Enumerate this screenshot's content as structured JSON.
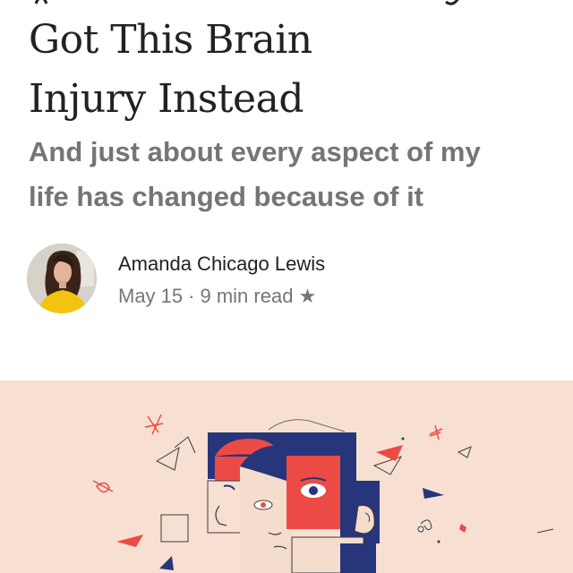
{
  "article": {
    "title_lines": [
      "Got This Brain",
      "Injury Instead"
    ],
    "subtitle_lines": [
      "And just about every aspect of my",
      "life has changed because of it"
    ],
    "author": {
      "name": "Amanda Chicago Lewis"
    },
    "meta": {
      "date": "May 15",
      "separator": "·",
      "read_time": "9 min read",
      "star": "★"
    }
  },
  "icons": {
    "star": "star-icon"
  },
  "colors": {
    "title": "#222222",
    "subtitle": "#757575",
    "hero_background": "#f7e0d2",
    "illustration_navy": "#27357a",
    "illustration_red": "#ec4b45",
    "illustration_skin": "#f5ddcd"
  }
}
